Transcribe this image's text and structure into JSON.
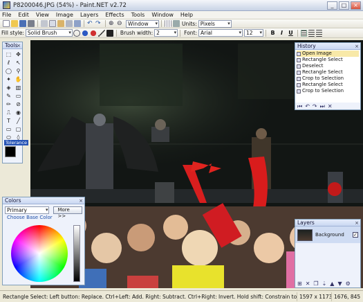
{
  "window": {
    "title": "P8200046.JPG (54%) - Paint.NET v2.72"
  },
  "menu": [
    "File",
    "Edit",
    "View",
    "Image",
    "Layers",
    "Effects",
    "Tools",
    "Window",
    "Help"
  ],
  "toolbar1": {
    "zoom_select": "Window",
    "units_label": "Units:",
    "units_value": "Pixels"
  },
  "toolbar2": {
    "fill_style_label": "Fill style:",
    "fill_style_value": "Solid Brush",
    "brush_width_label": "Brush width:",
    "brush_width_value": "2",
    "font_label": "Font:",
    "font_value": "Arial",
    "font_size_value": "12",
    "bold": "B",
    "italic": "I",
    "underline": "U"
  },
  "tools_palette": {
    "title": "Tools",
    "tooltip": "Tolerance"
  },
  "history": {
    "title": "History",
    "items": [
      "Open Image",
      "Rectangle Select",
      "Deselect",
      "Rectangle Select",
      "Crop to Selection",
      "Rectangle Select",
      "Crop to Selection"
    ]
  },
  "colors": {
    "title": "Colors",
    "mode": "Primary",
    "more_button": "More >>",
    "base_color_link": "Choose Base Color"
  },
  "layers": {
    "title": "Layers",
    "layer_name": "Background"
  },
  "status": {
    "hint": "Rectangle Select: Left button: Replace. Ctrl+Left: Add. Right: Subtract. Ctrl+Right: Invert. Hold shift: Constrain to square.",
    "image_size": "1597 x 1173",
    "cursor_pos": "1676, 845"
  }
}
